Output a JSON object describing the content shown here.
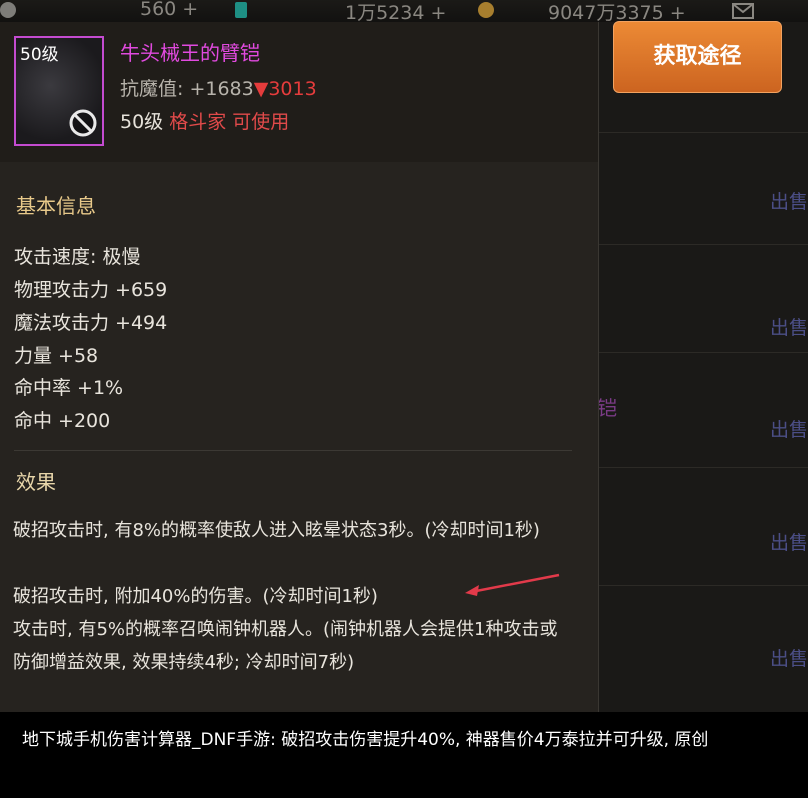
{
  "topbar": {
    "currency1": "560",
    "currency2": "1万5234",
    "currency3": "9047万3375",
    "plus": "+"
  },
  "item": {
    "level_badge": "50级",
    "name": "牛头械王的臂铠",
    "resist_label": "抗魔值: +1683",
    "resist_down": "▼3013",
    "req_level": "50级",
    "req_class": "格斗家 可使用"
  },
  "get_button": "获取途径",
  "basic_info": {
    "title": "基本信息",
    "stats": [
      "攻击速度: 极慢",
      "物理攻击力 +659",
      "魔法攻击力 +494",
      "力量 +58",
      "命中率 +1%",
      "命中 +200"
    ]
  },
  "effects": {
    "title": "效果",
    "lines": [
      "破招攻击时, 有8%的概率使敌人进入眩晕状态3秒。(冷却时间1秒)",
      "破招攻击时, 附加40%的伤害。(冷却时间1秒)",
      "攻击时, 有5%的概率召唤闹钟机器人。(闹钟机器人会提供1种攻击或防御增益效果, 效果持续4秒; 冷却时间7秒)"
    ]
  },
  "background_list": {
    "sell_label": "出售",
    "fragment": "铠"
  },
  "caption": "地下城手机伤害计算器_DNF手游: 破招攻击伤害提升40%, 神器售价4万泰拉并可升级, 原创",
  "colors": {
    "item_name": "#e14adf",
    "section_title": "#e8c98a",
    "button": "#e07a2c",
    "down": "#e53c3c"
  }
}
